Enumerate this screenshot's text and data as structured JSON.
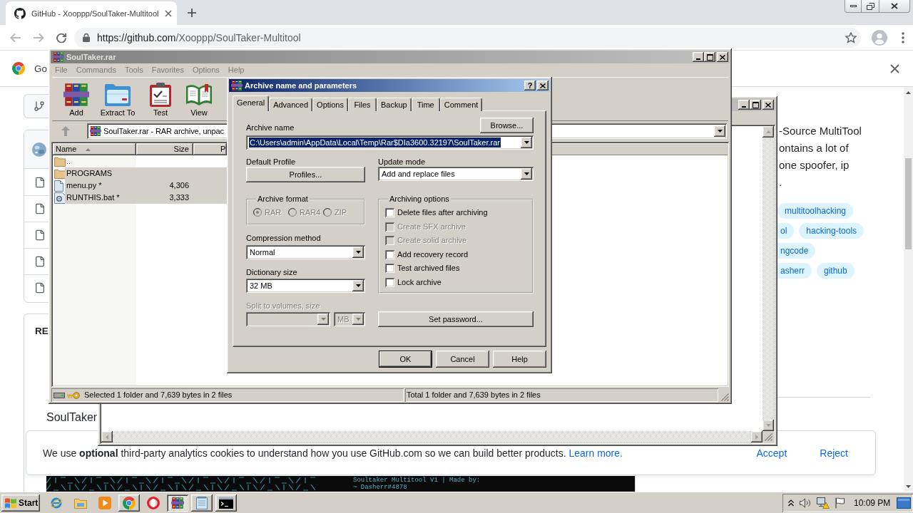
{
  "browser": {
    "tab": {
      "title": "GitHub - Xooppp/SoulTaker-Multitool"
    },
    "url": {
      "origin": "https://github.com",
      "path": "/Xooppp/SoulTaker-Multitool"
    },
    "infobar": {
      "text": "Go"
    },
    "page": {
      "readme_heading": "RE",
      "readme_title": "SoulTaker",
      "about_lines": [
        "-Source MultiTool",
        "ontains a lot of",
        "one spoofer, ip",
        "."
      ],
      "topic_rows": [
        [
          "multitoolhacking"
        ],
        [
          "ol",
          "hacking-tools"
        ],
        [
          "ngcode"
        ],
        [
          "asherr",
          "github"
        ]
      ],
      "terminal_lines": [
        "Soultaker Multitool V1 | Made by:",
        "~ Dasherr#4878"
      ]
    },
    "cookie_banner": {
      "text": "We use **optional** third-party analytics cookies to understand how you use GitHub.com so we can build better products.",
      "link": "Learn more.",
      "buttons": [
        "Accept",
        "Reject"
      ]
    }
  },
  "archive_window": {
    "title": "SoulTaker.rar",
    "menu": [
      {
        "label": "File",
        "disabled": true
      },
      {
        "label": "Commands",
        "disabled": true
      },
      {
        "label": "Tools",
        "disabled": true
      },
      {
        "label": "Favorites",
        "disabled": true
      },
      {
        "label": "Options",
        "disabled": true
      },
      {
        "label": "Help",
        "disabled": true
      }
    ],
    "toolbar": [
      {
        "label": "Add",
        "kind": "add"
      },
      {
        "label": "Extract To",
        "kind": "extract"
      },
      {
        "label": "Test",
        "kind": "test"
      },
      {
        "label": "View",
        "kind": "view"
      }
    ],
    "address": "SoulTaker.rar - RAR archive, unpac",
    "columns": [
      "Name",
      "Size",
      "P"
    ],
    "files": [
      {
        "name": "..",
        "kind": "folder",
        "selected": false
      },
      {
        "name": "PROGRAMS",
        "kind": "folder",
        "selected": true
      },
      {
        "name": "menu.py *",
        "size": "4,306",
        "kind": "file",
        "selected": true
      },
      {
        "name": "RUNTHIS.bat *",
        "size": "3,333",
        "kind": "batch",
        "selected": true
      }
    ],
    "status": {
      "selection": "Selected 1 folder and 7,639 bytes in 2 files",
      "total": "Total 1 folder and 7,639 bytes in 2 files"
    }
  },
  "dialog": {
    "title": "Archive name and parameters",
    "help_glyph": "?",
    "tabs": [
      {
        "label": "General",
        "selected": true
      },
      {
        "label": "Advanced",
        "selected": false
      },
      {
        "label": "Options",
        "selected": false
      },
      {
        "label": "Files",
        "selected": false
      },
      {
        "label": "Backup",
        "selected": false
      },
      {
        "label": "Time",
        "selected": false
      },
      {
        "label": "Comment",
        "selected": false
      }
    ],
    "archive_name": {
      "label": "Archive name",
      "value": "C:\\Users\\admin\\AppData\\Local\\Temp\\Rar$DIa3600.32197\\SoulTaker.rar",
      "selected": true,
      "button": "Browse..."
    },
    "profile": {
      "label": "Default Profile",
      "button": "Profiles..."
    },
    "update_mode": {
      "label": "Update mode",
      "value": "Add and replace files"
    },
    "archive_format": {
      "label": "Archive format",
      "options": [
        {
          "label": "RAR",
          "selected": true,
          "disabled": true
        },
        {
          "label": "RAR4",
          "selected": false,
          "disabled": true
        },
        {
          "label": "ZIP",
          "selected": false,
          "disabled": true
        }
      ]
    },
    "compression": {
      "label": "Compression method",
      "value": "Normal"
    },
    "dictionary": {
      "label": "Dictionary size",
      "value": "32 MB"
    },
    "split": {
      "label": "Split to volumes, size",
      "unit": "MB",
      "disabled": true
    },
    "archiving_options": {
      "label": "Archiving options",
      "items": [
        {
          "label": "Delete files after archiving",
          "checked": false,
          "disabled": false
        },
        {
          "label": "Create SFX archive",
          "checked": false,
          "disabled": true
        },
        {
          "label": "Create solid archive",
          "checked": false,
          "disabled": true
        },
        {
          "label": "Add recovery record",
          "checked": false,
          "disabled": false
        },
        {
          "label": "Test archived files",
          "checked": false,
          "disabled": false
        },
        {
          "label": "Lock archive",
          "checked": false,
          "disabled": false
        }
      ]
    },
    "password_button": "Set password...",
    "buttons": [
      {
        "label": "OK",
        "default": true
      },
      {
        "label": "Cancel",
        "default": false
      },
      {
        "label": "Help",
        "default": false
      }
    ]
  },
  "taskbar": {
    "start": "Start",
    "apps": [
      {
        "kind": "ie",
        "running": false,
        "active": false
      },
      {
        "kind": "explorer",
        "running": false,
        "active": false
      },
      {
        "kind": "media",
        "running": false,
        "active": false
      },
      {
        "kind": "chrome",
        "running": true,
        "active": false
      },
      {
        "kind": "opera",
        "running": false,
        "active": false
      },
      {
        "kind": "winrar",
        "running": true,
        "active": true
      },
      {
        "kind": "notepad",
        "running": true,
        "active": false
      },
      {
        "kind": "cmd",
        "running": true,
        "active": false
      }
    ],
    "clock": "10:09 PM"
  }
}
